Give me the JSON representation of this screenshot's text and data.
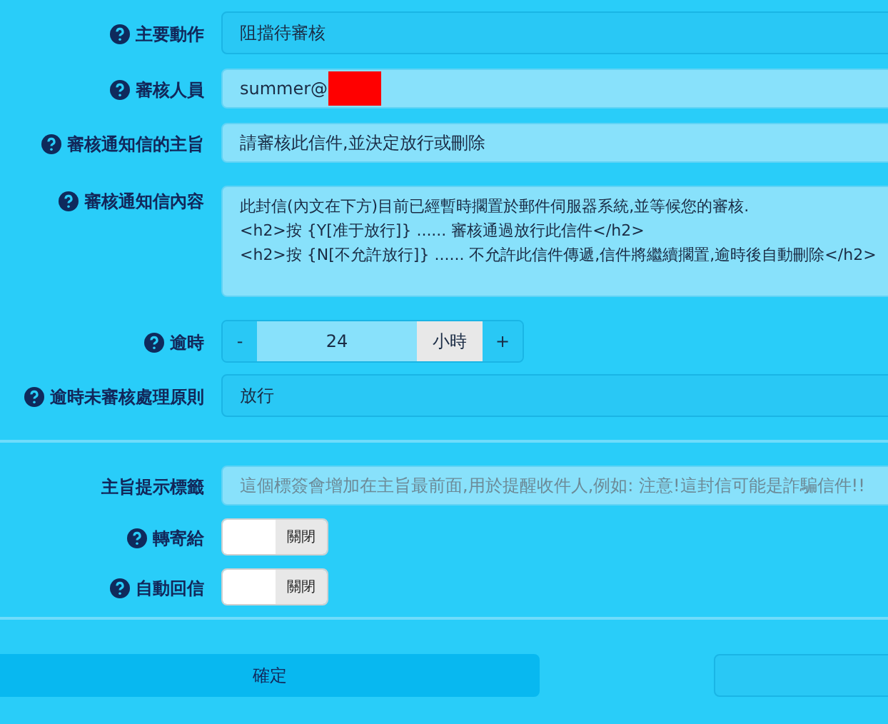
{
  "fields": [
    {
      "kind": "select",
      "label": "主要動作",
      "help_icon": true,
      "value": "阻擋待審核"
    },
    {
      "kind": "input",
      "label": "審核人員",
      "help_icon": true,
      "value": "summer@",
      "redacted": true
    },
    {
      "kind": "input",
      "label": "審核通知信的主旨",
      "help_icon": true,
      "value": "請審核此信件,並決定放行或刪除"
    },
    {
      "kind": "textarea",
      "label": "審核通知信內容",
      "help_icon": true,
      "lines": [
        "此封信(內文在下方)目前已經暫時擱置於郵件伺服器系統,並等候您的審核.",
        "<h2>按 {Y[准于放行]} ...... 審核通過放行此信件</h2>",
        "<h2>按 {N[不允許放行]} ...... 不允許此信件傳遞,信件將繼續擱置,逾時後自動刪除</h2>"
      ]
    },
    {
      "kind": "stepper",
      "label": "逾時",
      "help_icon": true,
      "minus": "-",
      "value": "24",
      "unit": "小時",
      "plus": "+"
    },
    {
      "kind": "select",
      "label": "逾時未審核處理原則",
      "help_icon": true,
      "value": "放行"
    },
    {
      "kind": "divider"
    },
    {
      "kind": "input",
      "label": "主旨提示標籤",
      "help_icon": false,
      "placeholder": "這個標簽會增加在主旨最前面,用於提醒收件人,例如: 注意!這封信可能是詐騙信件!!"
    },
    {
      "kind": "toggle",
      "label": "轉寄給",
      "help_icon": true,
      "on": false,
      "state_text": "關閉"
    },
    {
      "kind": "toggle",
      "label": "自動回信",
      "help_icon": true,
      "on": false,
      "state_text": "關閉"
    }
  ],
  "confirm_button": "確定"
}
